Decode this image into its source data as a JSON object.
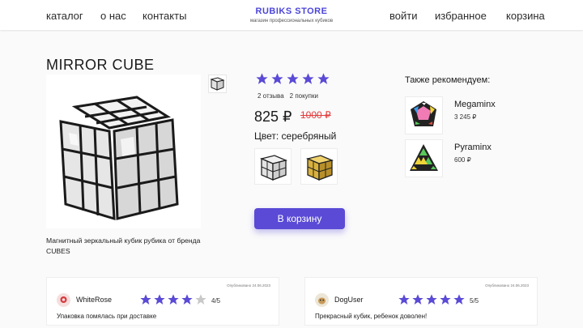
{
  "header": {
    "nav_left": [
      "каталог",
      "о нас",
      "контакты"
    ],
    "brand": {
      "title": "RUBIKS STORE",
      "subtitle": "магазин профессиональных кубиков"
    },
    "nav_right": [
      "войти",
      "избранное",
      "корзина"
    ]
  },
  "product": {
    "title": "MIRROR CUBE",
    "description": "Магнитный зеркальный кубик рубика от бренда CUBES",
    "rating": 5,
    "reviews_text": "2 отзыва",
    "purchases_text": "2 покупки",
    "price": "825 ₽",
    "old_price": "1000 ₽",
    "color_label": "Цвет: серебряный",
    "color_options": [
      {
        "name": "silver",
        "color": "#d8d8d8"
      },
      {
        "name": "gold",
        "color": "#d9b13c"
      }
    ],
    "cart_button": "В корзину"
  },
  "recommendations": {
    "title": "Также рекомендуем:",
    "items": [
      {
        "name": "Megaminx",
        "price": "3 245 ₽",
        "icon": "megaminx-icon"
      },
      {
        "name": "Pyraminx",
        "price": "600 ₽",
        "icon": "pyraminx-icon"
      }
    ]
  },
  "reviews": [
    {
      "user": "WhiteRose",
      "date": "Опубликовано 24.06.2023",
      "rating": 4,
      "score_text": "4/5",
      "text": "Упаковка помялась при доставке"
    },
    {
      "user": "DogUser",
      "date": "Опубликовано 24.06.2023",
      "rating": 5,
      "score_text": "5/5",
      "text": "Прекрасный кубик, ребенок доволен!"
    }
  ],
  "colors": {
    "accent": "#5a4ad6",
    "star_on": "#5a4ad6",
    "star_off": "#c8c8c8",
    "old_price": "#e23c3c"
  }
}
